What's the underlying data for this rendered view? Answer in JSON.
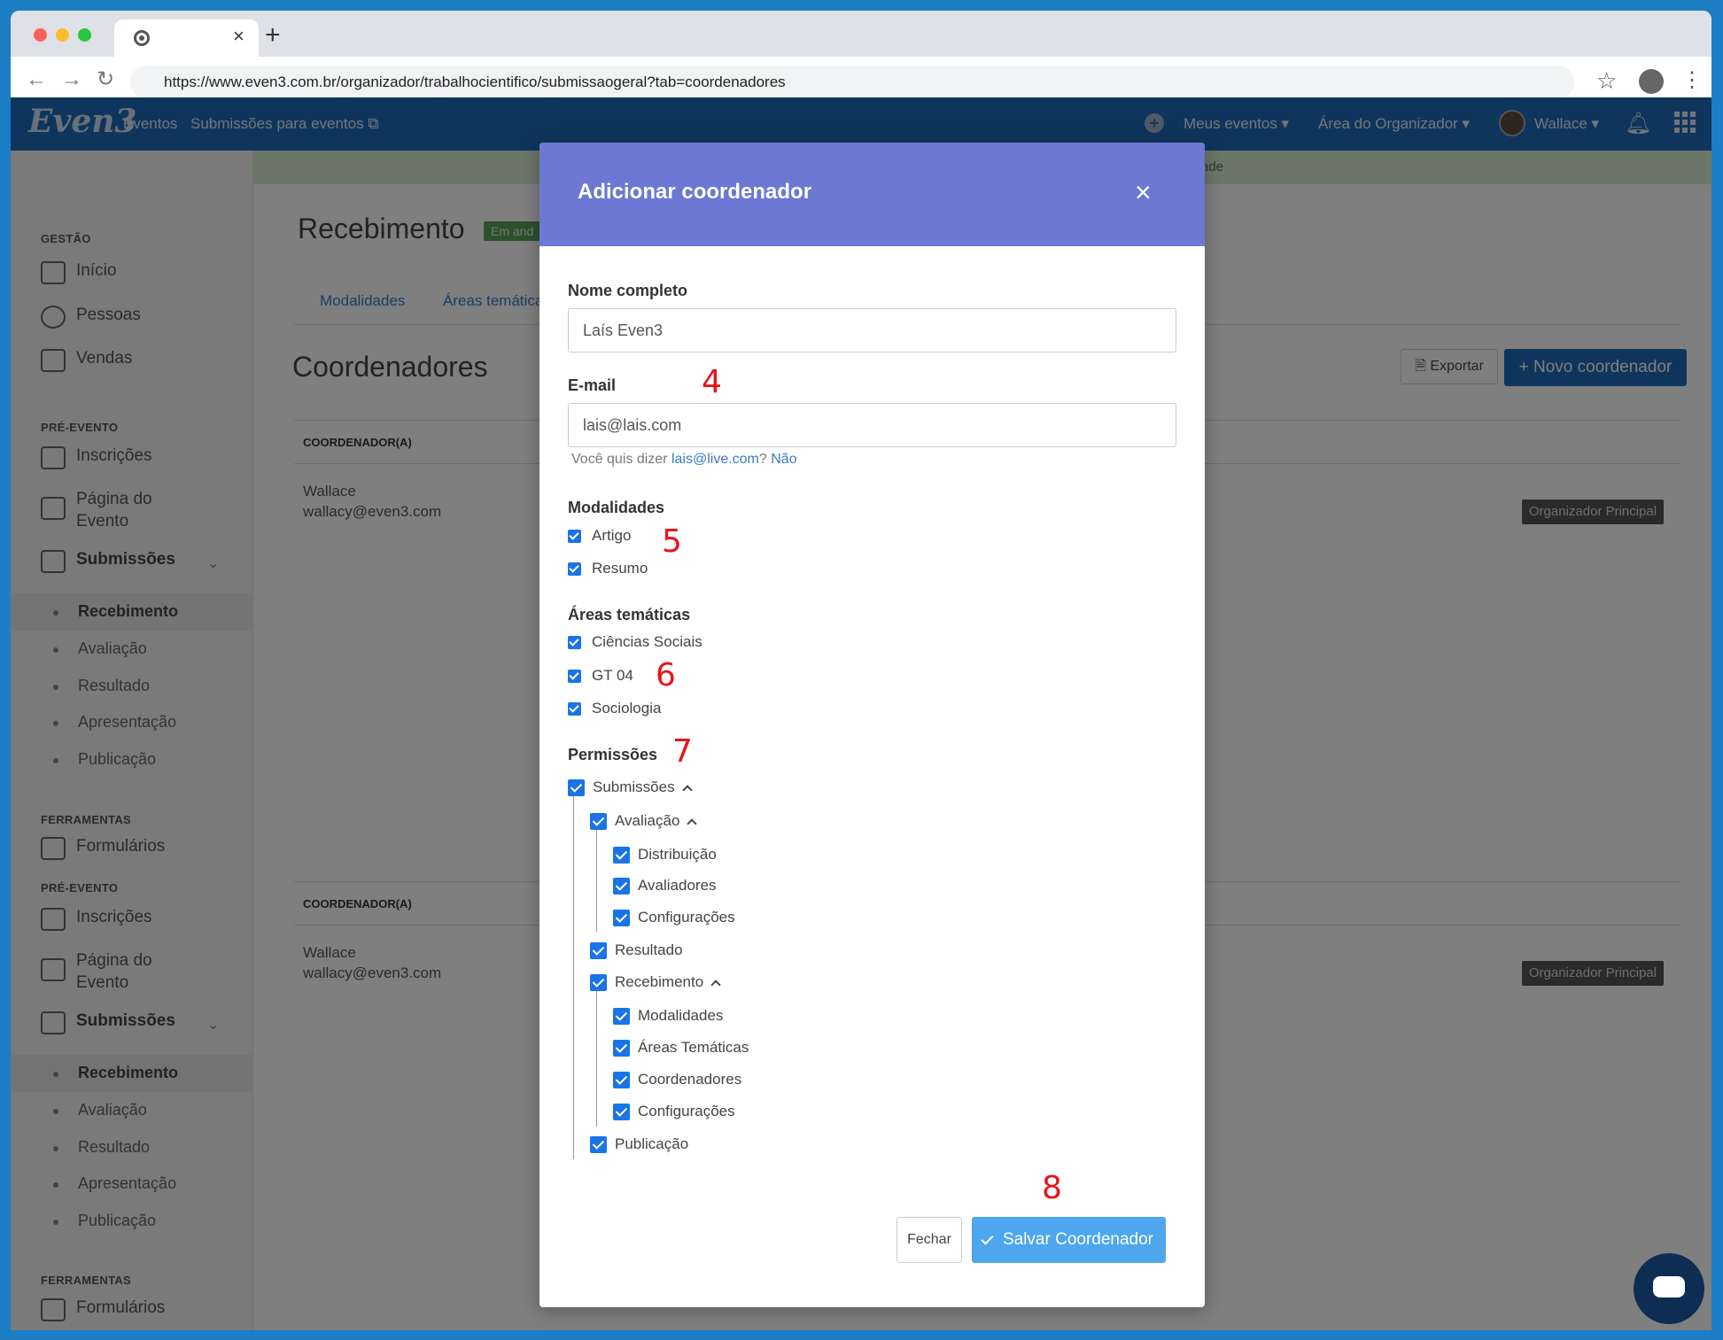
{
  "browser": {
    "new_tab": "+",
    "tab_close": "×",
    "url": "https://www.even3.com.br/organizador/trabalhocientifico/submissaogeral?tab=coordenadores"
  },
  "navbar": {
    "logo": "Even3",
    "eventos": "Eventos",
    "submissoes": "Submissões para eventos ⧉",
    "meus_eventos": "Meus eventos ▾",
    "area_organizador": "Área do Organizador ▾",
    "user": "Wallace ▾"
  },
  "sidebar": {
    "gestao": "GESTÃO",
    "inicio": "Início",
    "pessoas": "Pessoas",
    "vendas": "Vendas",
    "pre_evento": "PRÉ-EVENTO",
    "inscricoes": "Inscrições",
    "pagina_evento_1": "Página do",
    "pagina_evento_2": "Evento",
    "submissoes": "Submissões",
    "recebimento": "Recebimento",
    "avaliacao": "Avaliação",
    "resultado": "Resultado",
    "apresentacao": "Apresentação",
    "publicacao": "Publicação",
    "ferramentas": "FERRAMENTAS",
    "formularios": "Formulários"
  },
  "page": {
    "banner": "ade",
    "title": "Recebimento",
    "badge": "Em and",
    "tab_modalidades": "Modalidades",
    "tab_areas": "Áreas temática",
    "section_title": "Coordenadores",
    "export_btn": "Exportar",
    "new_btn": "+ Novo coordenador",
    "col_header": "COORDENADOR(A)",
    "coord_name": "Wallace",
    "coord_email": "wallacy@even3.com",
    "role": "Organizador Principal"
  },
  "modal": {
    "title": "Adicionar coordenador",
    "close": "×",
    "nome_label": "Nome completo",
    "nome_value": "Laís Even3",
    "email_label": "E-mail",
    "email_value": "lais@lais.com",
    "hint_prefix": "Você quis dizer ",
    "hint_suggestion": "lais@live.com",
    "hint_q": "? ",
    "hint_no": "Não",
    "modalidades_label": "Modalidades",
    "modalidades": [
      "Artigo",
      "Resumo"
    ],
    "areas_label": "Áreas temáticas",
    "areas": [
      "Ciências Sociais",
      "GT 04",
      "Sociologia"
    ],
    "permissoes_label": "Permissões",
    "perm_submissoes": "Submissões",
    "perm_avaliacao": "Avaliação",
    "perm_distribuicao": "Distribuição",
    "perm_avaliadores": "Avaliadores",
    "perm_config_1": "Configurações",
    "perm_resultado": "Resultado",
    "perm_recebimento": "Recebimento",
    "perm_modalidades": "Modalidades",
    "perm_areas": "Áreas Temáticas",
    "perm_coordenadores": "Coordenadores",
    "perm_config_2": "Configurações",
    "perm_publicacao": "Publicação",
    "fechar": "Fechar",
    "salvar": "Salvar Coordenador"
  },
  "annotations": [
    "4",
    "5",
    "6",
    "7",
    "8"
  ]
}
